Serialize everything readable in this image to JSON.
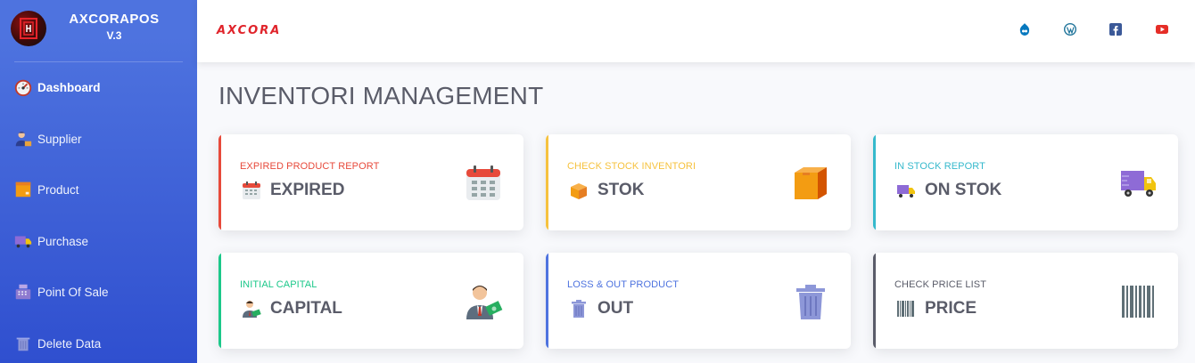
{
  "sidebar": {
    "brand_name": "AXCORAPOS",
    "brand_version": "V.3",
    "items": [
      {
        "label": "Dashboard",
        "icon": "speedometer-icon"
      },
      {
        "label": "Supplier",
        "icon": "supplier-person-icon"
      },
      {
        "label": "Product",
        "icon": "product-box-icon"
      },
      {
        "label": "Purchase",
        "icon": "delivery-truck-icon"
      },
      {
        "label": "Point Of Sale",
        "icon": "cash-register-icon"
      },
      {
        "label": "Delete Data",
        "icon": "trash-icon"
      }
    ]
  },
  "topbar": {
    "logo_text": "AXCORA",
    "icons": [
      "drupal-icon",
      "wordpress-icon",
      "facebook-icon",
      "youtube-icon"
    ]
  },
  "main": {
    "title": "INVENTORI MANAGEMENT",
    "cards": [
      {
        "subtitle": "EXPIRED PRODUCT REPORT",
        "title": "EXPIRED",
        "accent": "#e74a3b",
        "icon": "calendar-icon"
      },
      {
        "subtitle": "CHECK STOCK INVENTORI",
        "title": "STOK",
        "accent": "#f6c23e",
        "icon": "box-icon"
      },
      {
        "subtitle": "IN STOCK REPORT",
        "title": "ON STOK",
        "accent": "#36b9cc",
        "icon": "delivery-truck-icon"
      },
      {
        "subtitle": "INITIAL CAPITAL",
        "title": "CAPITAL",
        "accent": "#1cc88a",
        "icon": "businessman-money-icon"
      },
      {
        "subtitle": "LOSS & OUT PRODUCT",
        "title": "OUT",
        "accent": "#4e73df",
        "icon": "trash-icon"
      },
      {
        "subtitle": "CHECK PRICE LIST",
        "title": "PRICE",
        "accent": "#5a5c69",
        "icon": "barcode-icon"
      }
    ]
  },
  "colors": {
    "sidebar_top": "#4e73df",
    "sidebar_bottom": "#2f4fcf",
    "title_text": "#5a5c69",
    "logo_red": "#e0242b"
  }
}
